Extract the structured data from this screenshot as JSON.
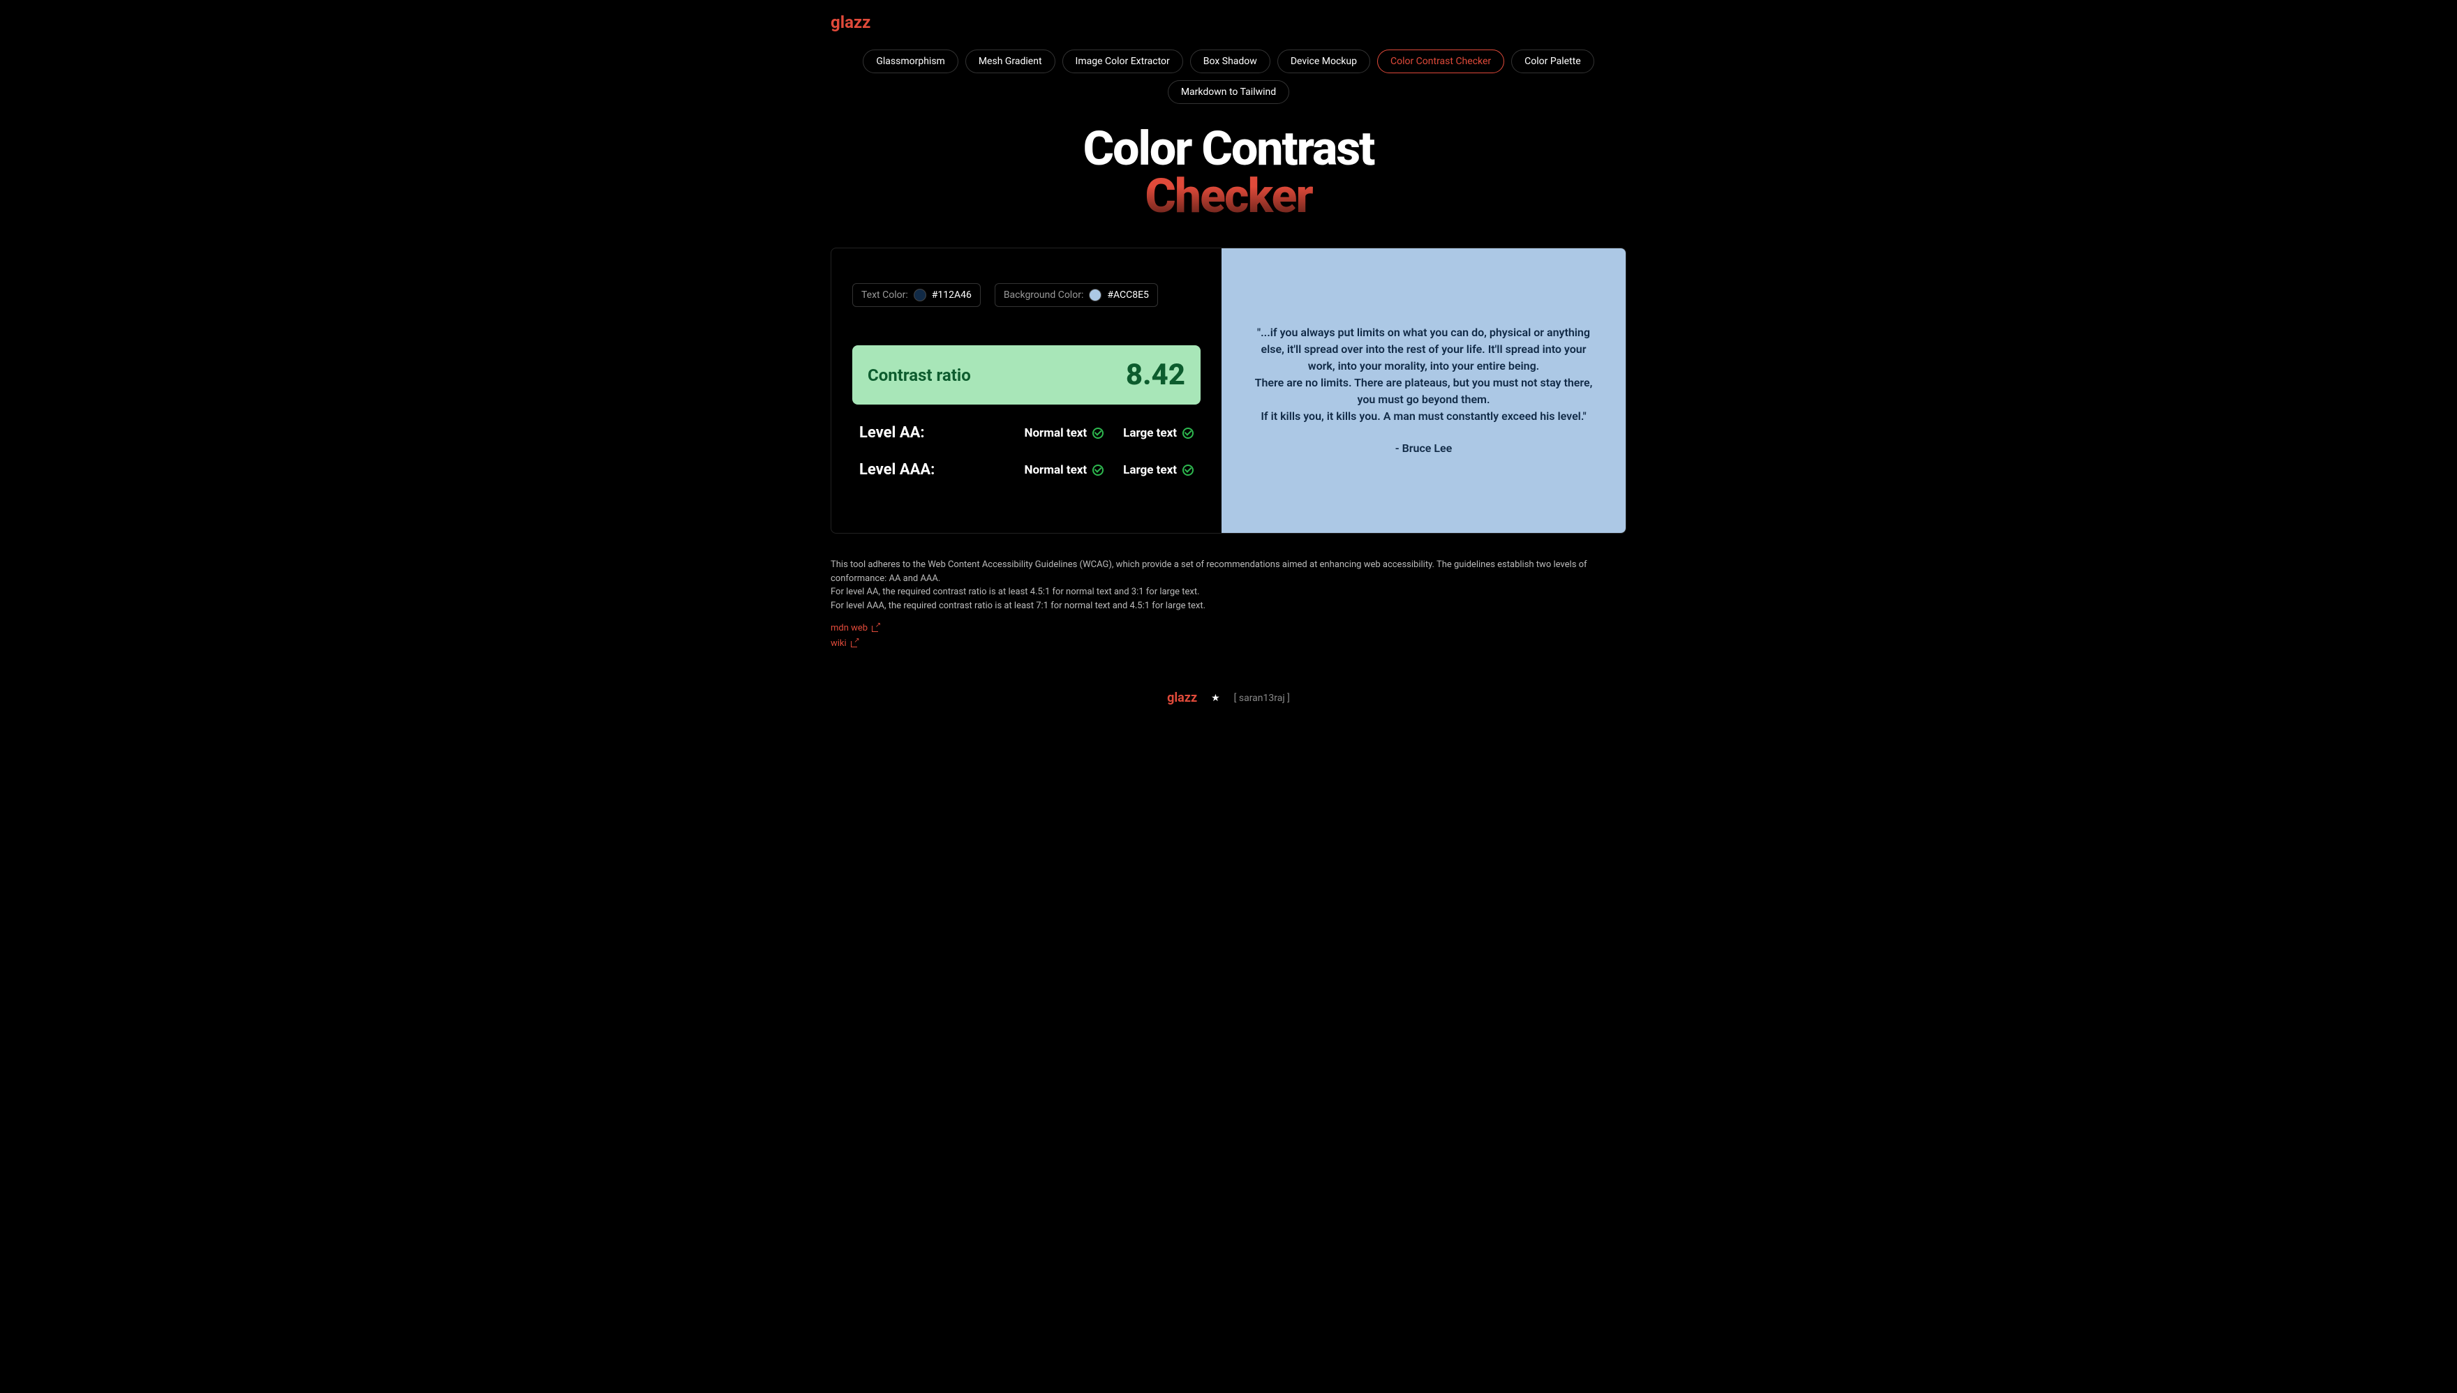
{
  "logo": "glazz",
  "nav": {
    "items": [
      {
        "label": "Glassmorphism",
        "active": false
      },
      {
        "label": "Mesh Gradient",
        "active": false
      },
      {
        "label": "Image Color Extractor",
        "active": false
      },
      {
        "label": "Box Shadow",
        "active": false
      },
      {
        "label": "Device Mockup",
        "active": false
      },
      {
        "label": "Color Contrast Checker",
        "active": true
      },
      {
        "label": "Color Palette",
        "active": false
      },
      {
        "label": "Markdown to Tailwind",
        "active": false
      }
    ]
  },
  "title": {
    "line1": "Color Contrast",
    "line2": "Checker"
  },
  "inputs": {
    "textColor": {
      "label": "Text Color:",
      "value": "#112A46",
      "swatch": "#112A46"
    },
    "bgColor": {
      "label": "Background Color:",
      "value": "#ACC8E5",
      "swatch": "#ACC8E5"
    }
  },
  "contrast": {
    "label": "Contrast ratio",
    "value": "8.42",
    "bgColor": "#a8e6b8",
    "fgColor": "#0d5c2e"
  },
  "levels": {
    "aa": {
      "label": "Level AA:",
      "normal": {
        "text": "Normal text",
        "pass": true
      },
      "large": {
        "text": "Large text",
        "pass": true
      }
    },
    "aaa": {
      "label": "Level AAA:",
      "normal": {
        "text": "Normal text",
        "pass": true
      },
      "large": {
        "text": "Large text",
        "pass": true
      }
    }
  },
  "preview": {
    "lines": [
      "\"...if you always put limits on what you can do, physical or anything else, it'll spread over into the rest of your life. It'll spread into your work, into your morality, into your entire being.",
      "There are no limits. There are plateaus, but you must not stay there, you must go beyond them.",
      "If it kills you, it kills you. A man must constantly exceed his level.\""
    ],
    "author": "- Bruce Lee"
  },
  "info": {
    "p1": "This tool adheres to the Web Content Accessibility Guidelines (WCAG), which provide a set of recommendations aimed at enhancing web accessibility. The guidelines establish two levels of conformance: AA and AAA.",
    "p2": "For level AA, the required contrast ratio is at least 4.5:1 for normal text and 3:1 for large text.",
    "p3": "For level AAA, the required contrast ratio is at least 7:1 for normal text and 4.5:1 for large text."
  },
  "resourceLinks": [
    {
      "label": "mdn web"
    },
    {
      "label": "wiki"
    }
  ],
  "footer": {
    "logo": "glazz",
    "star": "★",
    "credit": "[ saran13raj ]"
  }
}
